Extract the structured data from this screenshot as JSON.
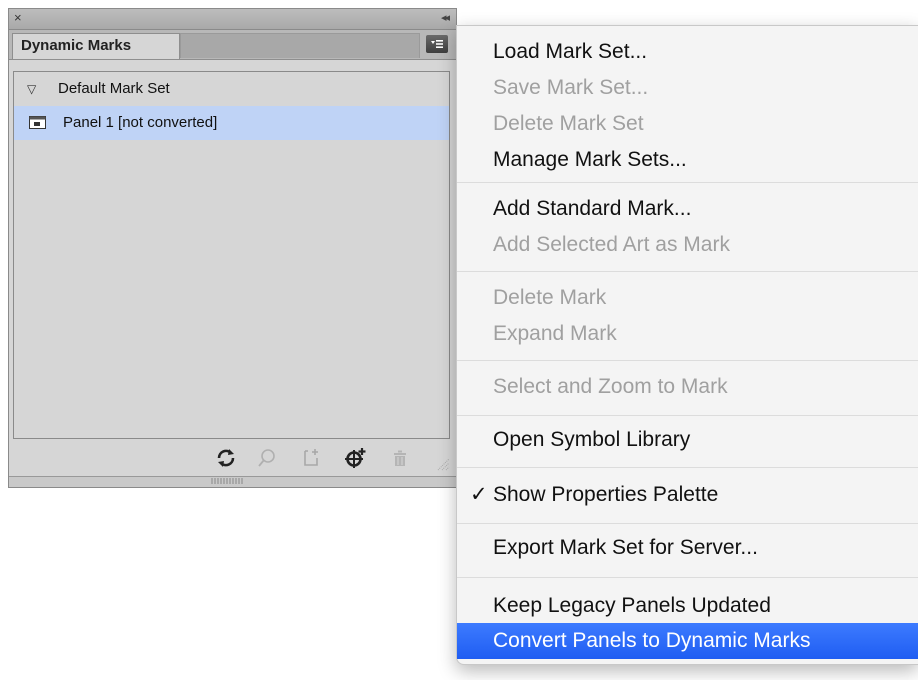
{
  "panel": {
    "close_glyph": "×",
    "collapse_glyph": "◂◂",
    "tab_label": "Dynamic Marks",
    "tree": {
      "group_label": "Default Mark Set",
      "item_label": "Panel 1 [not converted]"
    },
    "footer_icons": [
      "refresh-icon",
      "search-icon",
      "add-frame-icon",
      "add-mark-icon",
      "trash-icon"
    ]
  },
  "menu": {
    "items": [
      {
        "label": "Load Mark Set...",
        "enabled": true
      },
      {
        "label": "Save Mark Set...",
        "enabled": false
      },
      {
        "label": "Delete Mark Set",
        "enabled": false
      },
      {
        "label": "Manage Mark Sets...",
        "enabled": true
      },
      {
        "label": "Add Standard Mark...",
        "enabled": true
      },
      {
        "label": "Add Selected Art as Mark",
        "enabled": false
      },
      {
        "label": "Delete Mark",
        "enabled": false
      },
      {
        "label": "Expand Mark",
        "enabled": false
      },
      {
        "label": "Select and Zoom to Mark",
        "enabled": false
      },
      {
        "label": "Open Symbol Library",
        "enabled": true
      },
      {
        "label": "Show Properties Palette",
        "enabled": true,
        "checked": true
      },
      {
        "label": "Export Mark Set for Server...",
        "enabled": true
      },
      {
        "label": "Keep Legacy Panels Updated",
        "enabled": true
      },
      {
        "label": "Convert Panels to Dynamic Marks",
        "enabled": true,
        "selected": true
      }
    ],
    "check_glyph": "✓"
  },
  "colors": {
    "selection": "#2a66f6",
    "tree_selection": "#bfd3f6",
    "disabled_text": "#a0a0a0"
  }
}
